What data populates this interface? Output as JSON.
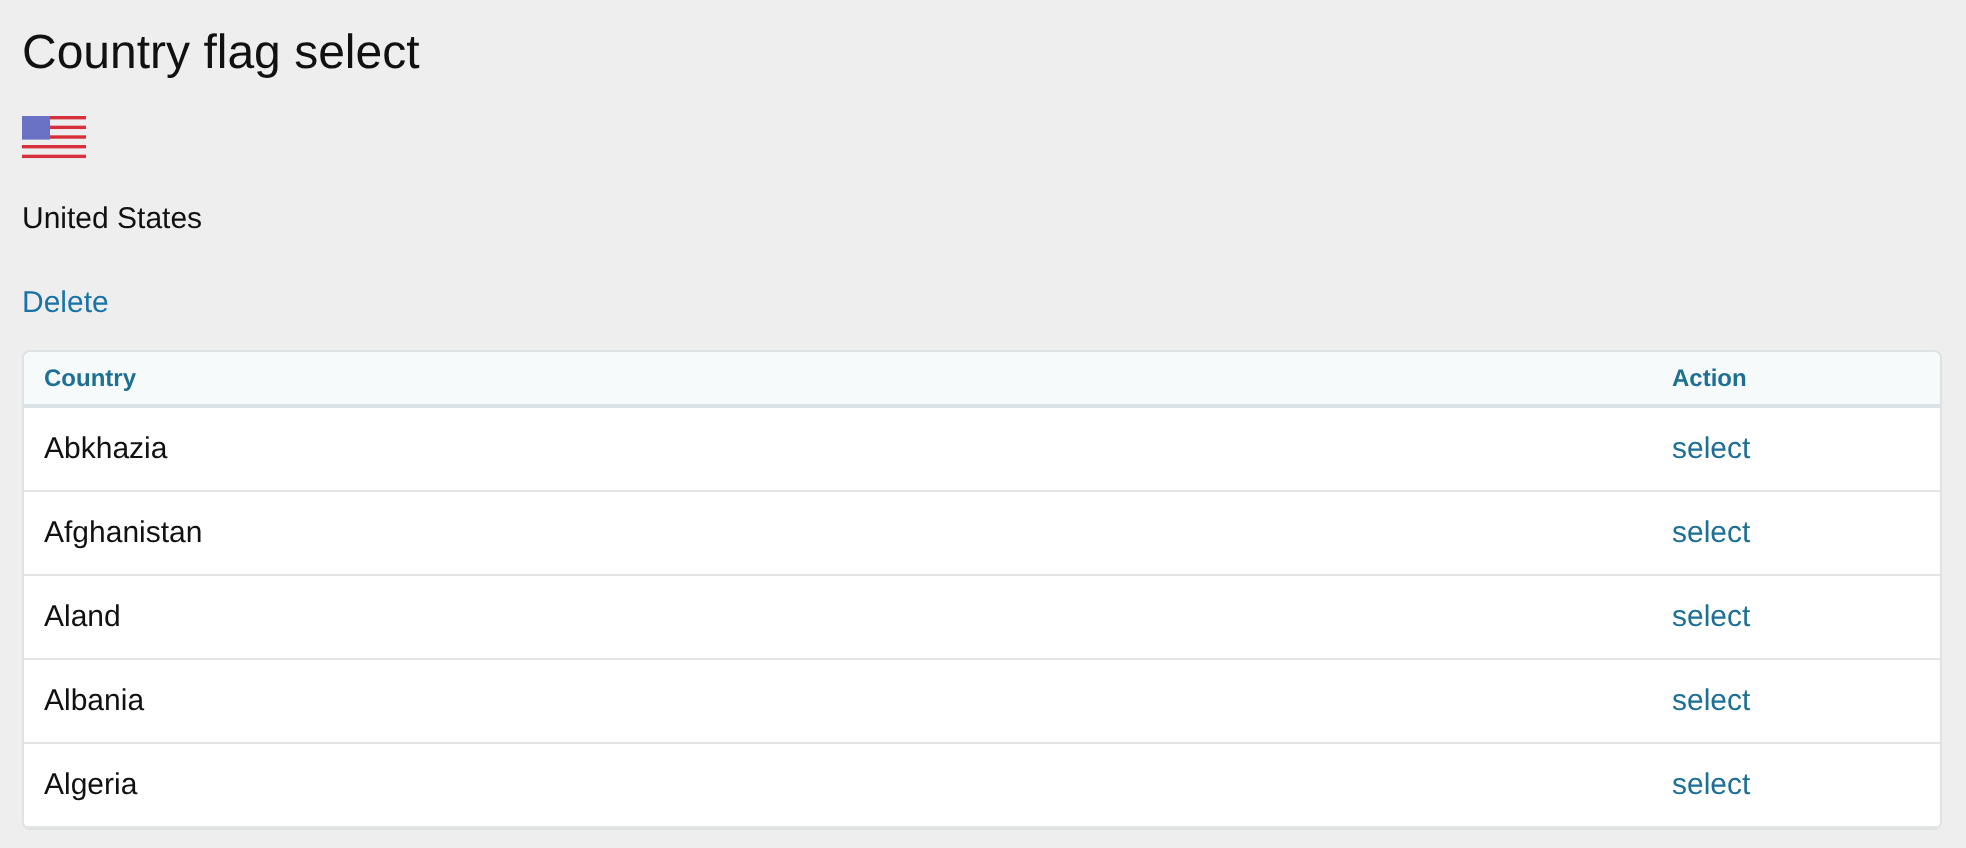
{
  "page": {
    "title": "Country flag select"
  },
  "selection": {
    "country": "United States",
    "delete_link": "Delete"
  },
  "table": {
    "columns": [
      "Country",
      "Action"
    ],
    "rows": [
      {
        "country": "Abkhazia",
        "action": "select"
      },
      {
        "country": "Afghanistan",
        "action": "select"
      },
      {
        "country": "Aland",
        "action": "select"
      },
      {
        "country": "Albania",
        "action": "select"
      },
      {
        "country": "Algeria",
        "action": "select"
      }
    ]
  }
}
